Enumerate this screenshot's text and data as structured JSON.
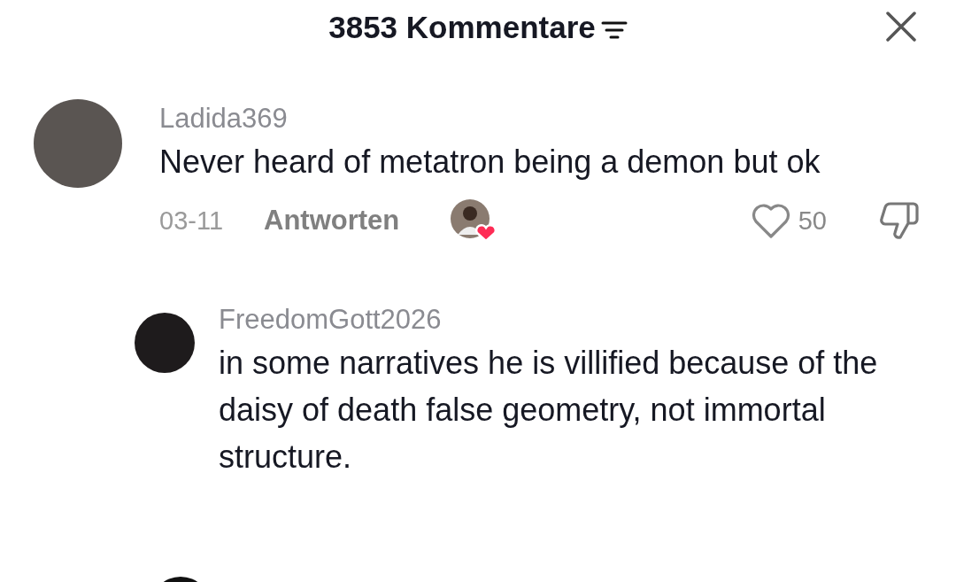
{
  "header": {
    "title": "3853 Kommentare"
  },
  "comments": [
    {
      "username": "Ladida369",
      "text": "Never heard of metatron being a demon but ok",
      "date": "03-11",
      "reply_label": "Antworten",
      "creator_liked": true,
      "likes": "50",
      "liked": false,
      "replies": [
        {
          "username": "FreedomGott2026",
          "text": "in some narratives he is villified because of the daisy of death false geometry, not immortal structure."
        }
      ]
    }
  ]
}
